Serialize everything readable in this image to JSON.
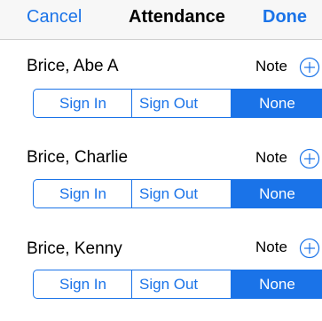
{
  "navbar": {
    "cancel_label": "Cancel",
    "title": "Attendance",
    "done_label": "Done"
  },
  "accent_color": "#1a73e8",
  "icons": {
    "note_add": "circle-plus-icon"
  },
  "people": [
    {
      "name": "Brice, Abe A",
      "note_label": "Note",
      "segments": {
        "sign_in": "Sign In",
        "sign_out": "Sign Out",
        "none": "None"
      },
      "selected": "None"
    },
    {
      "name": "Brice, Charlie",
      "note_label": "Note",
      "segments": {
        "sign_in": "Sign In",
        "sign_out": "Sign Out",
        "none": "None"
      },
      "selected": "None"
    },
    {
      "name": "Brice, Kenny",
      "note_label": "Note",
      "segments": {
        "sign_in": "Sign In",
        "sign_out": "Sign Out",
        "none": "None"
      },
      "selected": "None"
    }
  ]
}
